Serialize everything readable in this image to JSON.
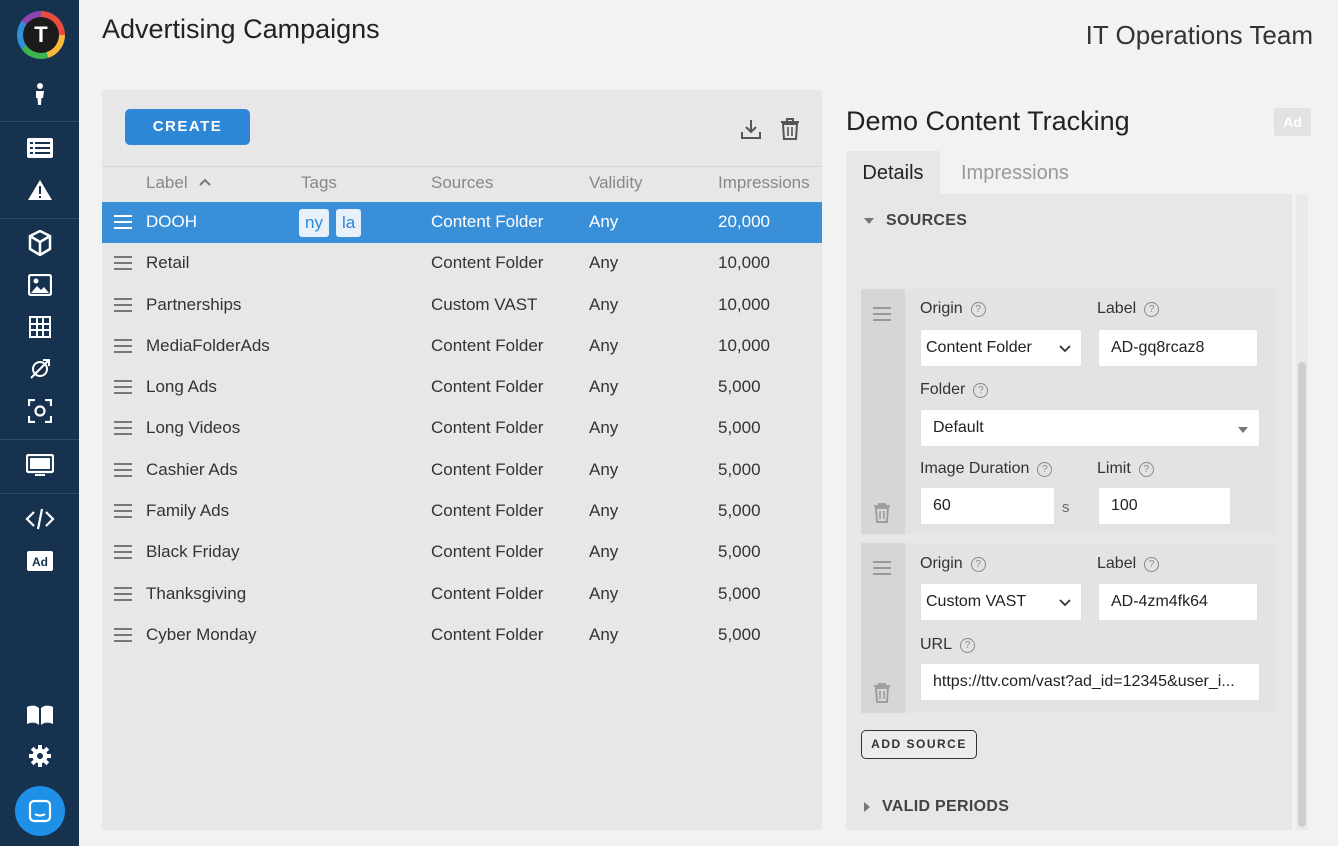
{
  "header": {
    "title": "Advertising Campaigns",
    "team": "IT Operations Team"
  },
  "sidebar": {
    "logo_letter": "T",
    "icons": [
      "person-icon",
      "list-icon",
      "alert-icon",
      "cube-icon",
      "image-icon",
      "grid-icon",
      "satellite-icon",
      "scan-icon",
      "monitor-icon",
      "code-icon",
      "ad-icon",
      "book-icon",
      "gear-icon",
      "chat-icon"
    ],
    "ad_text": "Ad"
  },
  "toolbar": {
    "create_label": "CREATE"
  },
  "table": {
    "columns": [
      "Label",
      "Tags",
      "Sources",
      "Validity",
      "Impressions"
    ],
    "sort_indicator": "^",
    "rows": [
      {
        "label": "DOOH",
        "tags": [
          "ny",
          "la"
        ],
        "source": "Content Folder",
        "validity": "Any",
        "impressions": "20,000",
        "selected": true
      },
      {
        "label": "Retail",
        "tags": [],
        "source": "Content Folder",
        "validity": "Any",
        "impressions": "10,000"
      },
      {
        "label": "Partnerships",
        "tags": [],
        "source": "Custom VAST",
        "validity": "Any",
        "impressions": "10,000"
      },
      {
        "label": "MediaFolderAds",
        "tags": [],
        "source": "Content Folder",
        "validity": "Any",
        "impressions": "10,000"
      },
      {
        "label": "Long Ads",
        "tags": [],
        "source": "Content Folder",
        "validity": "Any",
        "impressions": "5,000"
      },
      {
        "label": "Long Videos",
        "tags": [],
        "source": "Content Folder",
        "validity": "Any",
        "impressions": "5,000"
      },
      {
        "label": "Cashier Ads",
        "tags": [],
        "source": "Content Folder",
        "validity": "Any",
        "impressions": "5,000"
      },
      {
        "label": "Family Ads",
        "tags": [],
        "source": "Content Folder",
        "validity": "Any",
        "impressions": "5,000"
      },
      {
        "label": "Black Friday",
        "tags": [],
        "source": "Content Folder",
        "validity": "Any",
        "impressions": "5,000"
      },
      {
        "label": "Thanksgiving",
        "tags": [],
        "source": "Content Folder",
        "validity": "Any",
        "impressions": "5,000"
      },
      {
        "label": "Cyber Monday",
        "tags": [],
        "source": "Content Folder",
        "validity": "Any",
        "impressions": "5,000"
      }
    ]
  },
  "detail": {
    "title": "Demo Content Tracking",
    "badge": "Ad",
    "tabs": [
      "Details",
      "Impressions"
    ],
    "sources_heading": "SOURCES",
    "valid_periods_heading": "VALID PERIODS",
    "add_source_label": "ADD SOURCE",
    "help_glyph": "?",
    "source1": {
      "origin_label": "Origin",
      "origin_value": "Content Folder",
      "label_label": "Label",
      "label_value": "AD-gq8rcaz8",
      "folder_label": "Folder",
      "folder_value": "Default",
      "duration_label": "Image Duration",
      "duration_value": "60",
      "duration_unit": "s",
      "limit_label": "Limit",
      "limit_value": "100"
    },
    "source2": {
      "origin_label": "Origin",
      "origin_value": "Custom VAST",
      "label_label": "Label",
      "label_value": "AD-4zm4fk64",
      "url_label": "URL",
      "url_value": "https://ttv.com/vast?ad_id=12345&user_i..."
    }
  },
  "colors": {
    "sidebar": "#17324f",
    "accent": "#2e86d6",
    "selected_row": "#3a8fd9"
  }
}
